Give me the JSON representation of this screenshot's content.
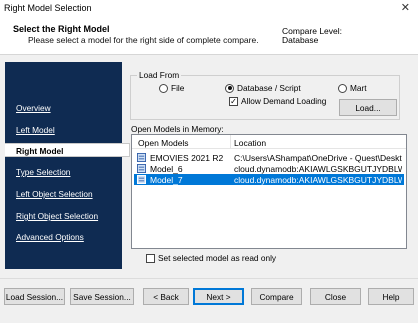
{
  "window": {
    "title": "Right Model Selection"
  },
  "header": {
    "title": "Select the Right Model",
    "subtitle": "Please select a model for the right side of complete compare.",
    "compare_level_label": "Compare Level:",
    "compare_level_value": "Database"
  },
  "sidebar": {
    "items": [
      {
        "label": "Overview"
      },
      {
        "label": "Left Model"
      },
      {
        "label": "Right Model",
        "active": true
      },
      {
        "label": "Type Selection"
      },
      {
        "label": "Left Object Selection"
      },
      {
        "label": "Right Object Selection"
      },
      {
        "label": "Advanced Options"
      }
    ]
  },
  "load_from": {
    "legend": "Load From",
    "options": [
      {
        "label": "File",
        "selected": false
      },
      {
        "label": "Database / Script",
        "selected": true
      },
      {
        "label": "Mart",
        "selected": false
      }
    ],
    "allow_demand_loading": {
      "label": "Allow Demand Loading",
      "checked": true
    },
    "load_button": "Load..."
  },
  "open_models": {
    "label": "Open Models in Memory:",
    "columns": [
      "Open Models",
      "Location"
    ],
    "rows": [
      {
        "name": "EMOVIES 2021 R2",
        "location": "C:\\Users\\AShampat\\OneDrive - Quest\\Desktop\\...",
        "selected": false
      },
      {
        "name": "Model_6",
        "location": "cloud.dynamodb:AKIAWLGSKBGUTJYDBLWB:A6...",
        "selected": false
      },
      {
        "name": "Model_7",
        "location": "cloud.dynamodb:AKIAWLGSKBGUTJYDBLWB:A6...",
        "selected": true
      }
    ]
  },
  "readonly_option": {
    "label": "Set selected model as read only",
    "checked": false
  },
  "footer": {
    "load_session": "Load Session...",
    "save_session": "Save Session...",
    "back": "< Back",
    "next": "Next >",
    "compare": "Compare",
    "close": "Close",
    "help": "Help"
  },
  "colors": {
    "nav_bg": "#0f2b52",
    "selection": "#0078d7"
  }
}
